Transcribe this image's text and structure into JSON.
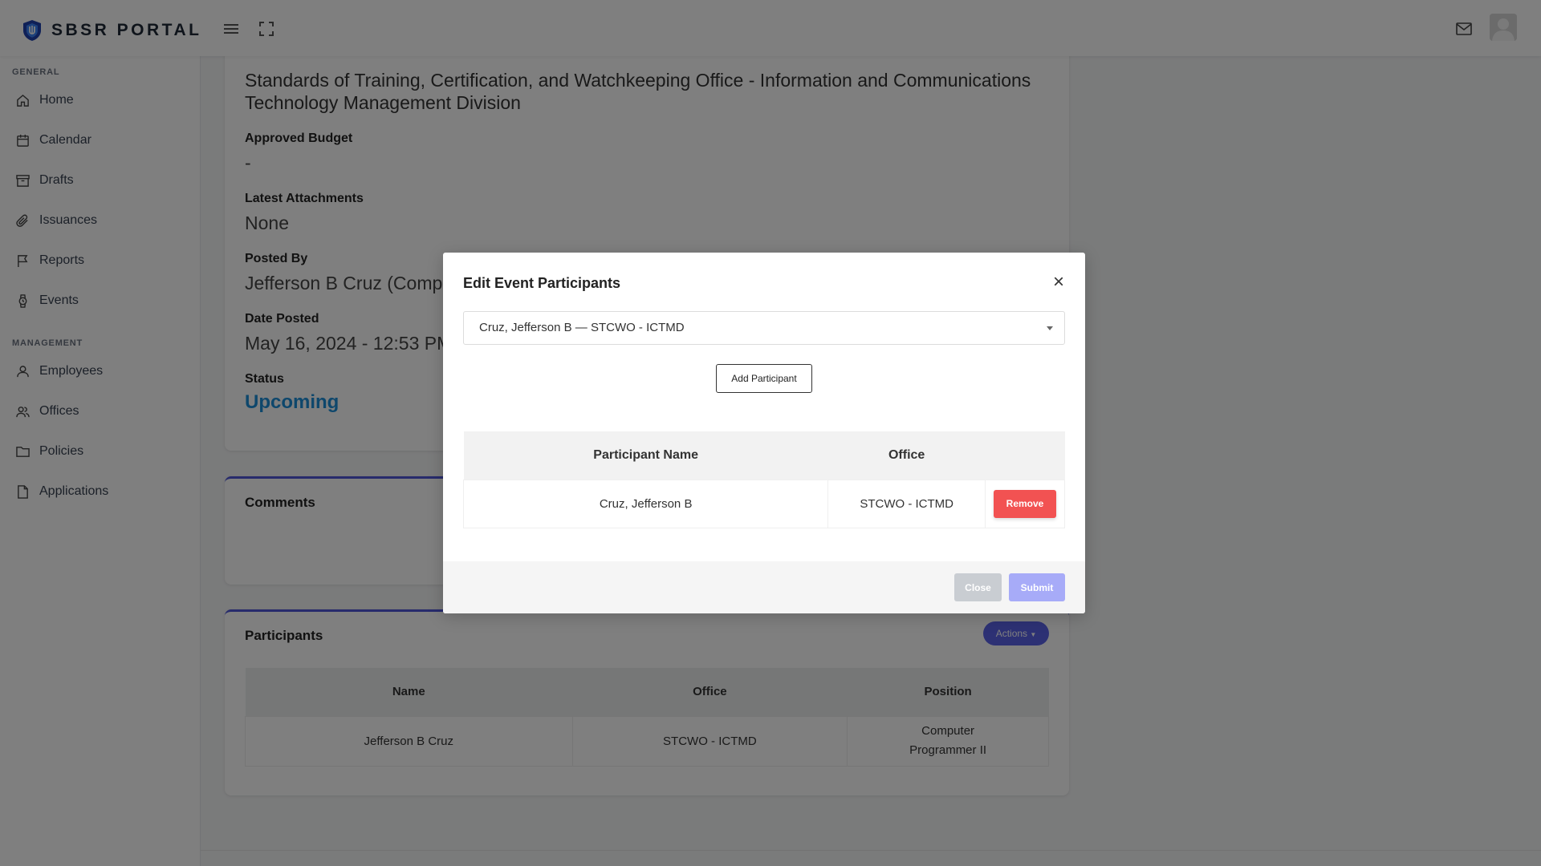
{
  "brand": {
    "name": "SBSR PORTAL",
    "logo_icon": "shield-logo-icon",
    "accent": "#1e40af"
  },
  "topbar": {
    "menu_icon": "hamburger-icon",
    "fullscreen_icon": "fullscreen-icon",
    "mail_icon": "mail-icon",
    "avatar_icon": "user-avatar-icon"
  },
  "sidebar": {
    "general_label": "GENERAL",
    "general_items": [
      {
        "label": "Home",
        "icon": "home-icon"
      },
      {
        "label": "Calendar",
        "icon": "calendar-icon"
      },
      {
        "label": "Drafts",
        "icon": "archive-icon"
      },
      {
        "label": "Issuances",
        "icon": "paperclip-icon"
      },
      {
        "label": "Reports",
        "icon": "flag-icon"
      },
      {
        "label": "Events",
        "icon": "watch-icon"
      }
    ],
    "management_label": "MANAGEMENT",
    "management_items": [
      {
        "label": "Employees",
        "icon": "user-icon"
      },
      {
        "label": "Offices",
        "icon": "users-icon"
      },
      {
        "label": "Policies",
        "icon": "folder-icon"
      },
      {
        "label": "Applications",
        "icon": "file-icon"
      }
    ]
  },
  "event": {
    "office": "Standards of Training, Certification, and Watchkeeping Office - Information and Communications Technology Management Division",
    "approved_budget_label": "Approved Budget",
    "approved_budget": "-",
    "attachments_label": "Latest Attachments",
    "attachments": "None",
    "posted_by_label": "Posted By",
    "posted_by": "Jefferson B Cruz (Compu",
    "date_posted_label": "Date Posted",
    "date_posted": "May 16, 2024 - 12:53 PM",
    "status_label": "Status",
    "status": "Upcoming",
    "status_color": "#1d8ed8"
  },
  "comments": {
    "title": "Comments"
  },
  "participants": {
    "title": "Participants",
    "actions_label": "Actions",
    "columns": [
      "Name",
      "Office",
      "Position"
    ],
    "rows": [
      {
        "name": "Jefferson B Cruz",
        "office": "STCWO - ICTMD",
        "position_line1": "Computer",
        "position_line2": "Programmer II"
      }
    ]
  },
  "modal": {
    "title": "Edit Event Participants",
    "close_icon": "close-icon",
    "selected_participant": "Cruz, Jefferson B — STCWO - ICTMD",
    "add_button": "Add Participant",
    "columns": [
      "Participant Name",
      "Office"
    ],
    "rows": [
      {
        "name": "Cruz, Jefferson B",
        "office": "STCWO - ICTMD",
        "remove_label": "Remove"
      }
    ],
    "close_button": "Close",
    "submit_button": "Submit",
    "remove_color": "#f25252",
    "submit_color": "#a7abf8"
  }
}
